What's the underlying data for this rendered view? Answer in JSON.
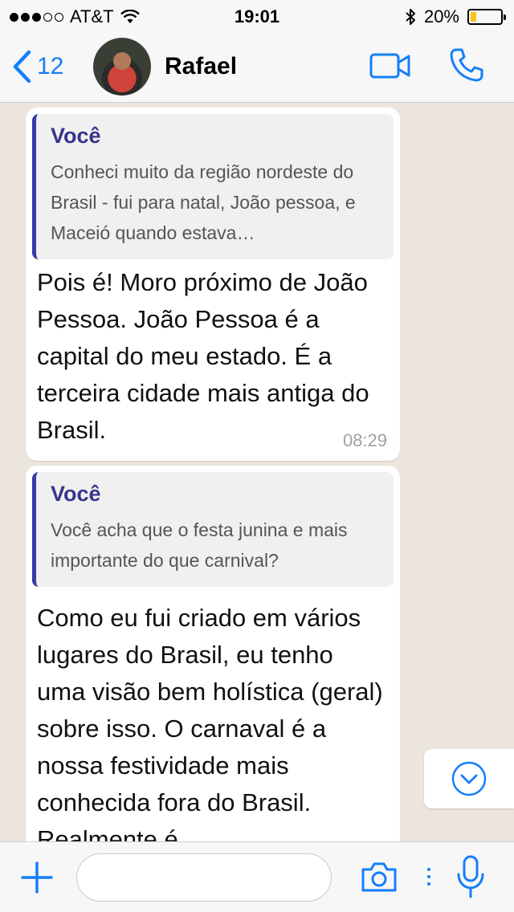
{
  "status_bar": {
    "carrier": "AT&T",
    "signal_bars_filled": 3,
    "signal_bars_total": 5,
    "time": "19:01",
    "battery_percent": "20%",
    "battery_level": 0.2
  },
  "nav": {
    "back_count": "12",
    "contact_name": "Rafael",
    "icons": [
      "chevron-left-icon",
      "video-call-icon",
      "phone-icon"
    ],
    "accent_color": "#157efb"
  },
  "messages": [
    {
      "quote_author": "Você",
      "quote_text": "Conheci muito da região nordeste do Brasil - fui para natal, João pessoa, e Maceió quando estava…",
      "text": "Pois é! Moro próximo de João Pessoa. João Pessoa é a capital do meu estado. É a terceira cidade mais antiga do Brasil.",
      "time": "08:29"
    },
    {
      "quote_author": "Você",
      "quote_text": "Você acha que o festa junina e mais importante do que carnival?",
      "text": "Como eu fui criado em vários lugares do Brasil, eu tenho uma visão bem holística (geral) sobre isso. O carnaval é a nossa festividade mais conhecida fora do Brasil. Realmente é"
    }
  ],
  "input_bar": {
    "placeholder": "",
    "icons": [
      "plus-icon",
      "camera-icon",
      "microphone-icon"
    ]
  },
  "colors": {
    "quote_bar": "#3a3aa8",
    "quote_author": "#35358c",
    "chat_background": "#ece5dd"
  }
}
